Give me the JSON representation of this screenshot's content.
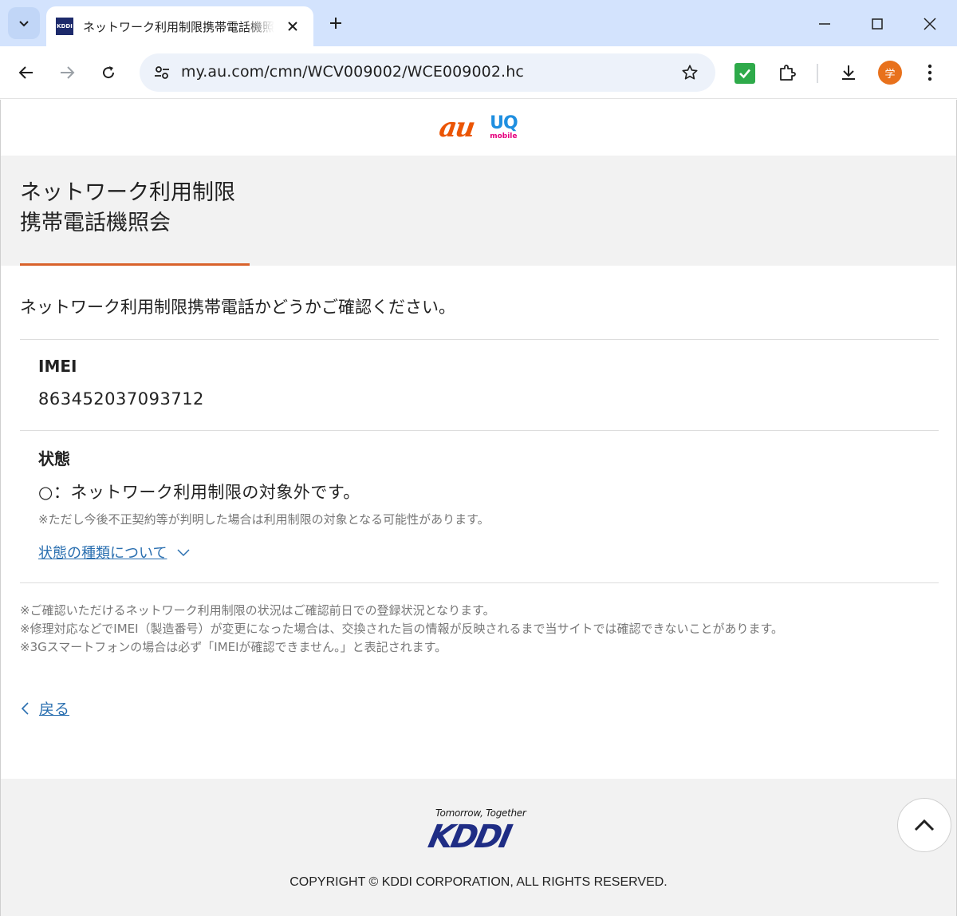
{
  "browser": {
    "tab_title": "ネットワーク利用制限携帯電話機照会",
    "favicon_label": "KDDI",
    "url": "my.au.com/cmn/WCV009002/WCE009002.hc",
    "profile_initial": "学"
  },
  "header": {
    "au_logo": "au",
    "uq_logo": "UQ",
    "uq_sub": "mobile"
  },
  "page": {
    "title_line1": "ネットワーク利用制限",
    "title_line2": "携帯電話機照会",
    "lead": "ネットワーク利用制限携帯電話かどうかご確認ください。",
    "imei_label": "IMEI",
    "imei_value": "863452037093712",
    "status_label": "状態",
    "status_value": "○：ネットワーク利用制限の対象外です。",
    "status_note": "※ただし今後不正契約等が判明した場合は利用制限の対象となる可能性があります。",
    "status_types_link": "状態の種類について",
    "notes": [
      "※ご確認いただけるネットワーク利用制限の状況はご確認前日での登録状況となります。",
      "※修理対応などでIMEI（製造番号）が変更になった場合は、交換された旨の情報が反映されるまで当サイトでは確認できないことがあります。",
      "※3Gスマートフォンの場合は必ず「IMEIが確認できません。」と表記されます。"
    ],
    "back_label": "戻る"
  },
  "footer": {
    "tagline": "Tomorrow, Together",
    "logo": "KDDI",
    "copyright": "COPYRIGHT © KDDI CORPORATION, ALL RIGHTS RESERVED."
  },
  "colors": {
    "accent_orange": "#d9622b",
    "link_blue": "#2a6fb0",
    "kddi_navy": "#1f2d85",
    "band_gray": "#f2f2f2"
  }
}
